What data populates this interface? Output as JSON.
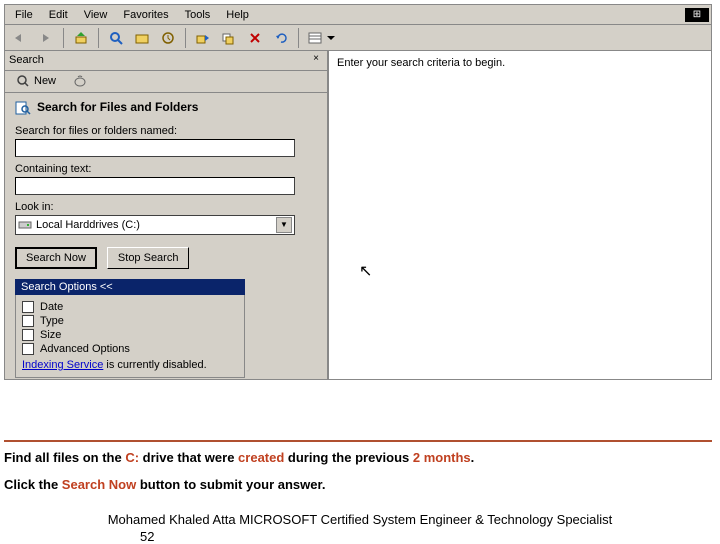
{
  "menubar": {
    "items": [
      "File",
      "Edit",
      "View",
      "Favorites",
      "Tools",
      "Help"
    ]
  },
  "toolbar": {
    "icons": [
      "back",
      "forward",
      "up",
      "search",
      "folders",
      "history",
      "move",
      "copy",
      "delete",
      "undo",
      "views"
    ]
  },
  "search_pane": {
    "title": "Search",
    "close": "×",
    "new_label": "New",
    "section_title": "Search for Files and Folders",
    "name_label": "Search for files or folders named:",
    "name_value": "",
    "text_label": "Containing text:",
    "text_value": "",
    "lookin_label": "Look in:",
    "lookin_value": "Local Harddrives (C:)",
    "search_now": "Search Now",
    "stop_search": "Stop Search",
    "options_header": "Search Options <<",
    "options": {
      "date": "Date",
      "type": "Type",
      "size": "Size",
      "advanced": "Advanced Options"
    },
    "indexing_link": "Indexing Service",
    "indexing_suffix": " is currently disabled."
  },
  "results": {
    "prompt": "Enter your search criteria to begin."
  },
  "instructions": {
    "line1_a": "Find all files on the ",
    "line1_b": "C:",
    "line1_c": " drive that were ",
    "line1_d": "created",
    "line1_e": " during the previous ",
    "line1_f": "2 months",
    "line1_g": ".",
    "line2_a": "Click the ",
    "line2_b": "Search Now",
    "line2_c": " button to submit your answer."
  },
  "footer": {
    "text": "Mohamed Khaled Atta MICROSOFT Certified System Engineer & Technology Specialist",
    "page": "52"
  }
}
